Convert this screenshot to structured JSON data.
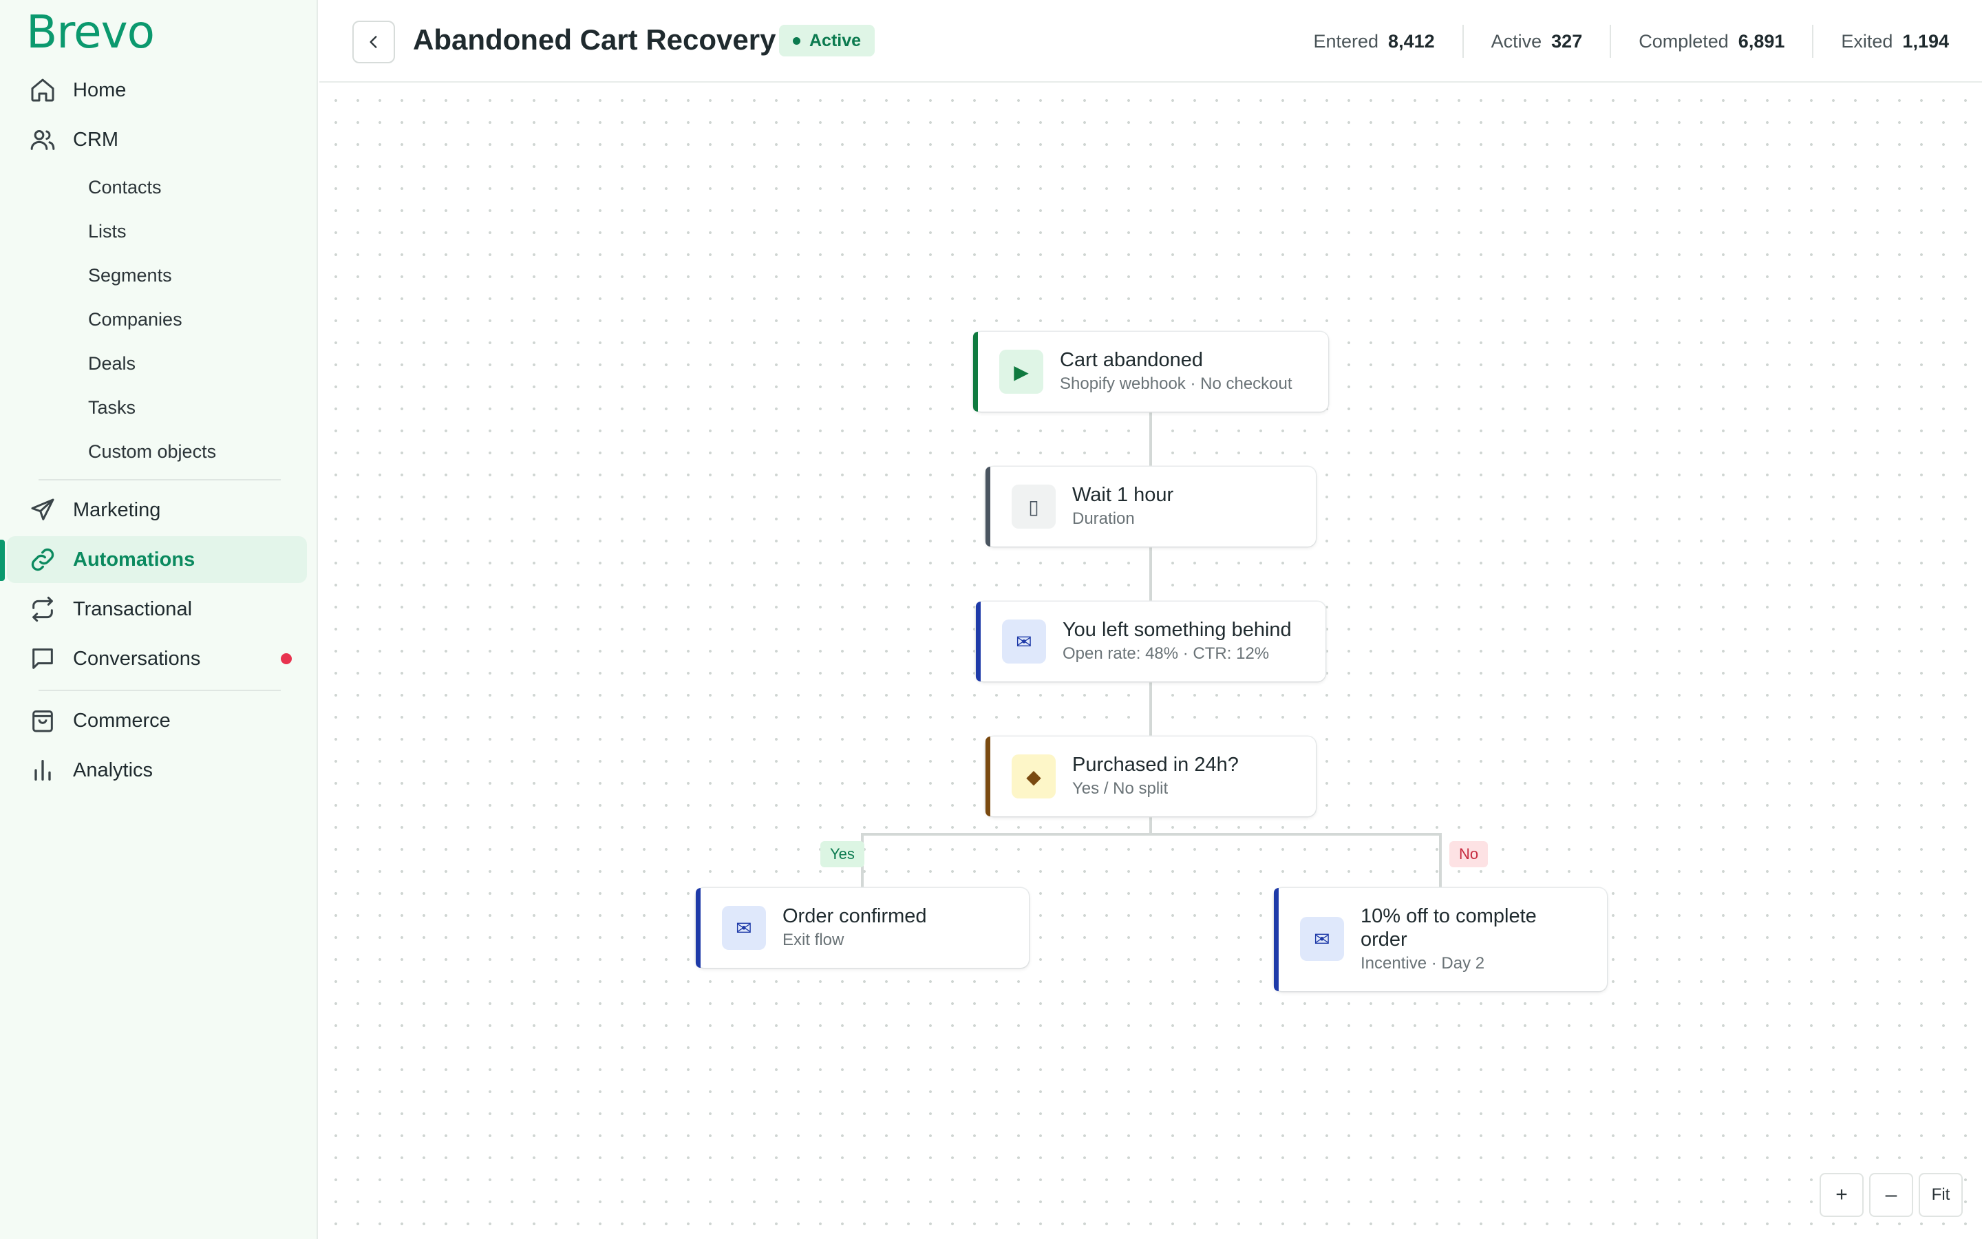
{
  "brand": {
    "logo_text": "Brevo",
    "accent": "#0b996e"
  },
  "sidebar": {
    "nav": [
      {
        "id": "home",
        "label": "Home",
        "icon": "home-icon"
      },
      {
        "id": "crm",
        "label": "CRM",
        "icon": "users-icon"
      },
      {
        "id": "marketing",
        "label": "Marketing",
        "icon": "send-icon"
      },
      {
        "id": "automations",
        "label": "Automations",
        "icon": "link-icon",
        "active": true
      },
      {
        "id": "transactional",
        "label": "Transactional",
        "icon": "repeat-icon"
      },
      {
        "id": "conversations",
        "label": "Conversations",
        "icon": "chat-icon",
        "has_notification": true
      },
      {
        "id": "commerce",
        "label": "Commerce",
        "icon": "bag-icon"
      },
      {
        "id": "analytics",
        "label": "Analytics",
        "icon": "bar-chart-icon"
      }
    ],
    "crm_sub": [
      "Contacts",
      "Lists",
      "Segments",
      "Companies",
      "Deals",
      "Tasks",
      "Custom objects"
    ]
  },
  "header": {
    "title": "Abandoned Cart Recovery",
    "status": "Active",
    "stats": [
      {
        "label": "Entered",
        "value": "8,412"
      },
      {
        "label": "Active",
        "value": "327"
      },
      {
        "label": "Completed",
        "value": "6,891"
      },
      {
        "label": "Exited",
        "value": "1,194"
      }
    ]
  },
  "workflow": {
    "nodes": [
      {
        "id": "trigger",
        "type": "trigger",
        "icon": "play-icon",
        "glyph": "▶",
        "title": "Cart abandoned",
        "subtitle": "Shopify webhook · No checkout",
        "accent": "#0f7a3f",
        "icon_bg": "#dff5e6",
        "icon_color": "#0f7a3f"
      },
      {
        "id": "wait",
        "type": "delay",
        "icon": "hourglass-icon",
        "glyph": "▯",
        "title": "Wait 1 hour",
        "subtitle": "Duration",
        "accent": "#4a5560",
        "icon_bg": "#f0f2f2",
        "icon_color": "#4a5560"
      },
      {
        "id": "email1",
        "type": "email",
        "icon": "envelope-icon",
        "glyph": "✉",
        "title": "You left something behind",
        "subtitle": "Open rate: 48% · CTR: 12%",
        "accent": "#1e3aa8",
        "icon_bg": "#dfe8fb",
        "icon_color": "#1e3aa8"
      },
      {
        "id": "condition",
        "type": "condition",
        "icon": "diamond-icon",
        "glyph": "◆",
        "title": "Purchased in 24h?",
        "subtitle": "Yes / No split",
        "accent": "#7a4a10",
        "icon_bg": "#fdf6c8",
        "icon_color": "#7a4a10"
      },
      {
        "id": "yes_email",
        "type": "email",
        "icon": "envelope-icon",
        "glyph": "✉",
        "title": "Order confirmed",
        "subtitle": "Exit flow",
        "accent": "#1e3aa8",
        "icon_bg": "#dfe8fb",
        "icon_color": "#1e3aa8"
      },
      {
        "id": "no_email",
        "type": "email",
        "icon": "envelope-icon",
        "glyph": "✉",
        "title": "10% off to complete order",
        "subtitle": "Incentive · Day 2",
        "accent": "#1e3aa8",
        "icon_bg": "#dfe8fb",
        "icon_color": "#1e3aa8"
      }
    ],
    "branches": {
      "yes": "Yes",
      "no": "No"
    }
  },
  "zoom_controls": {
    "zoom_in": "+",
    "zoom_out": "–",
    "fit": "Fit"
  }
}
